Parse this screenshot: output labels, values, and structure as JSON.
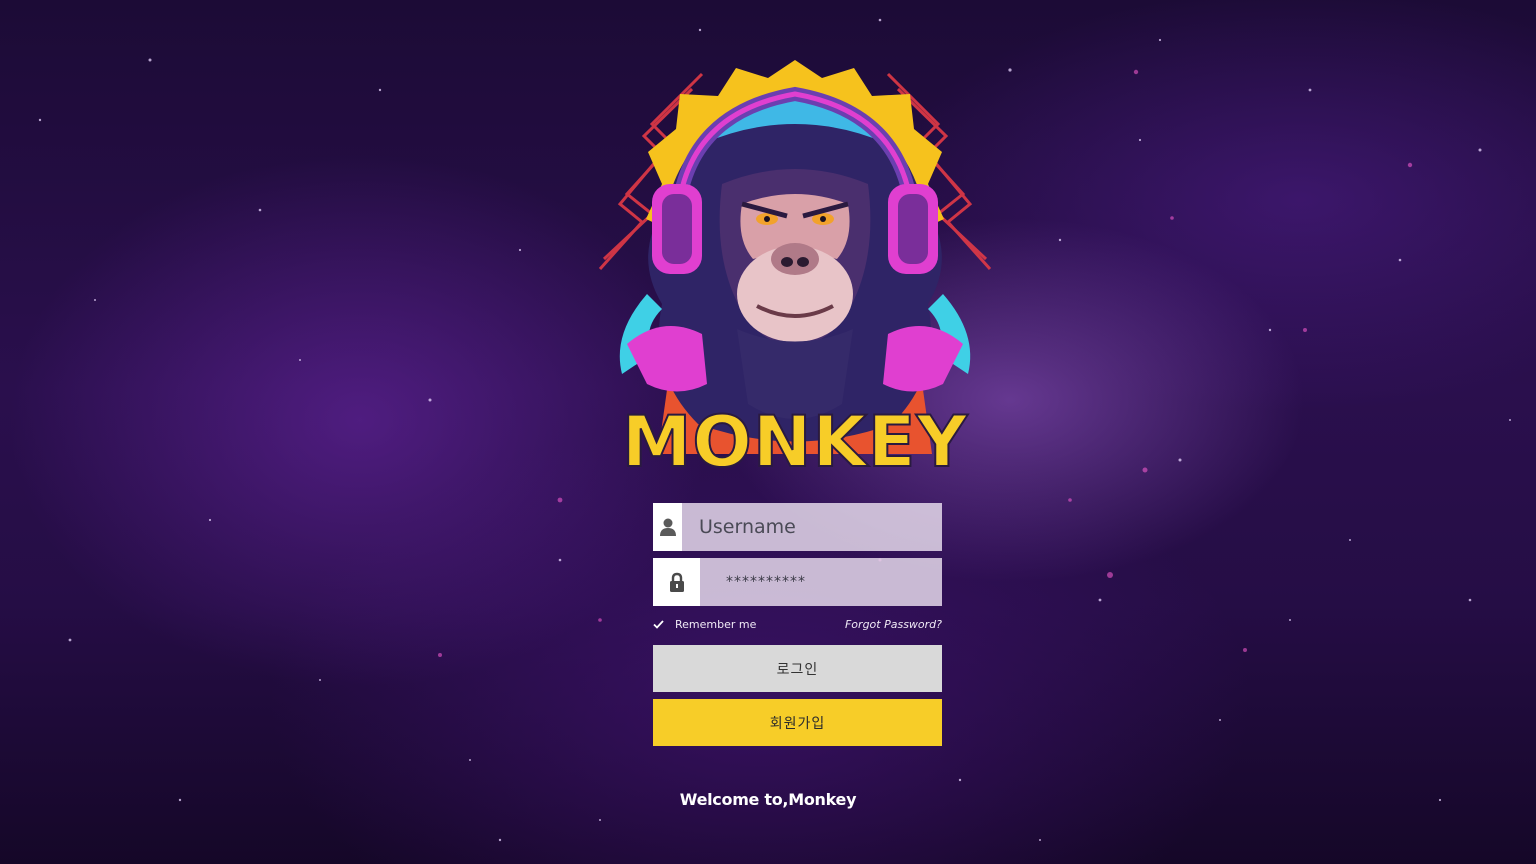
{
  "brand": {
    "logo_text": "MONKEY"
  },
  "login_form": {
    "username_placeholder": "Username",
    "password_value": "**********",
    "remember_label": "Remember me",
    "remember_checked": true,
    "forgot_label": "Forgot Password?",
    "login_button_label": "로그인",
    "signup_button_label": "회원가입"
  },
  "footer": {
    "welcome_text": "Welcome to,Monkey"
  },
  "icons": {
    "username": "user-icon",
    "password": "lock-icon",
    "remember": "check-icon"
  },
  "colors": {
    "background": "#2a0f4d",
    "accent_yellow": "#f7cd28",
    "login_button": "#d9d9d9",
    "logo_pink": "#e03fd0",
    "logo_cyan": "#3fd0e6"
  }
}
